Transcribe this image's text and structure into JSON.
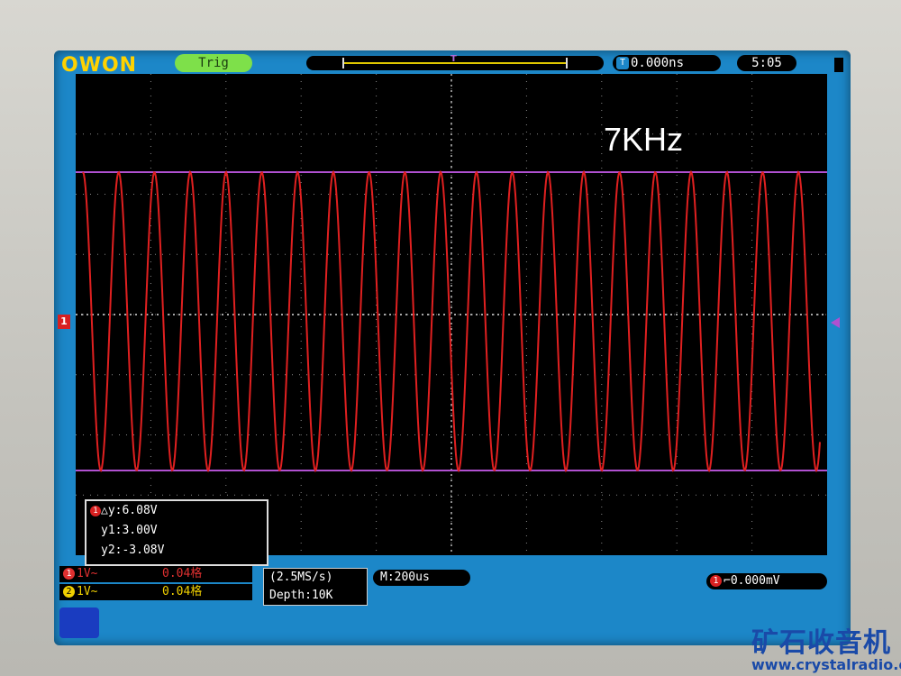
{
  "header": {
    "logo": "OWON",
    "trig_status": "Trig",
    "trigger_marker": "T",
    "trigger_position": "0.000ns",
    "clock": "5:05"
  },
  "overlay_label": "7KHz",
  "cursor_readout": {
    "delta_y": "△y:6.08V",
    "y1": "y1:3.00V",
    "y2": "y2:-3.08V"
  },
  "channels": [
    {
      "num": "1",
      "coupling": "1V~",
      "scale": "0.04格",
      "color": "#e03030"
    },
    {
      "num": "2",
      "coupling": "1V~",
      "scale": "0.04格",
      "color": "#f0d000"
    }
  ],
  "acquisition": {
    "sample_rate": "(2.5MS/s)",
    "depth": "Depth:10K",
    "timebase": "M:200us"
  },
  "trigger": {
    "channel": "1",
    "level": "⌐0.000mV"
  },
  "watermark": {
    "cn": "矿石收音机",
    "url": "www.crystalradio.cn"
  },
  "colors": {
    "screen_blue": "#1c87c8",
    "waveform": "#e02020",
    "cursor_lines": "#b050d0"
  }
}
